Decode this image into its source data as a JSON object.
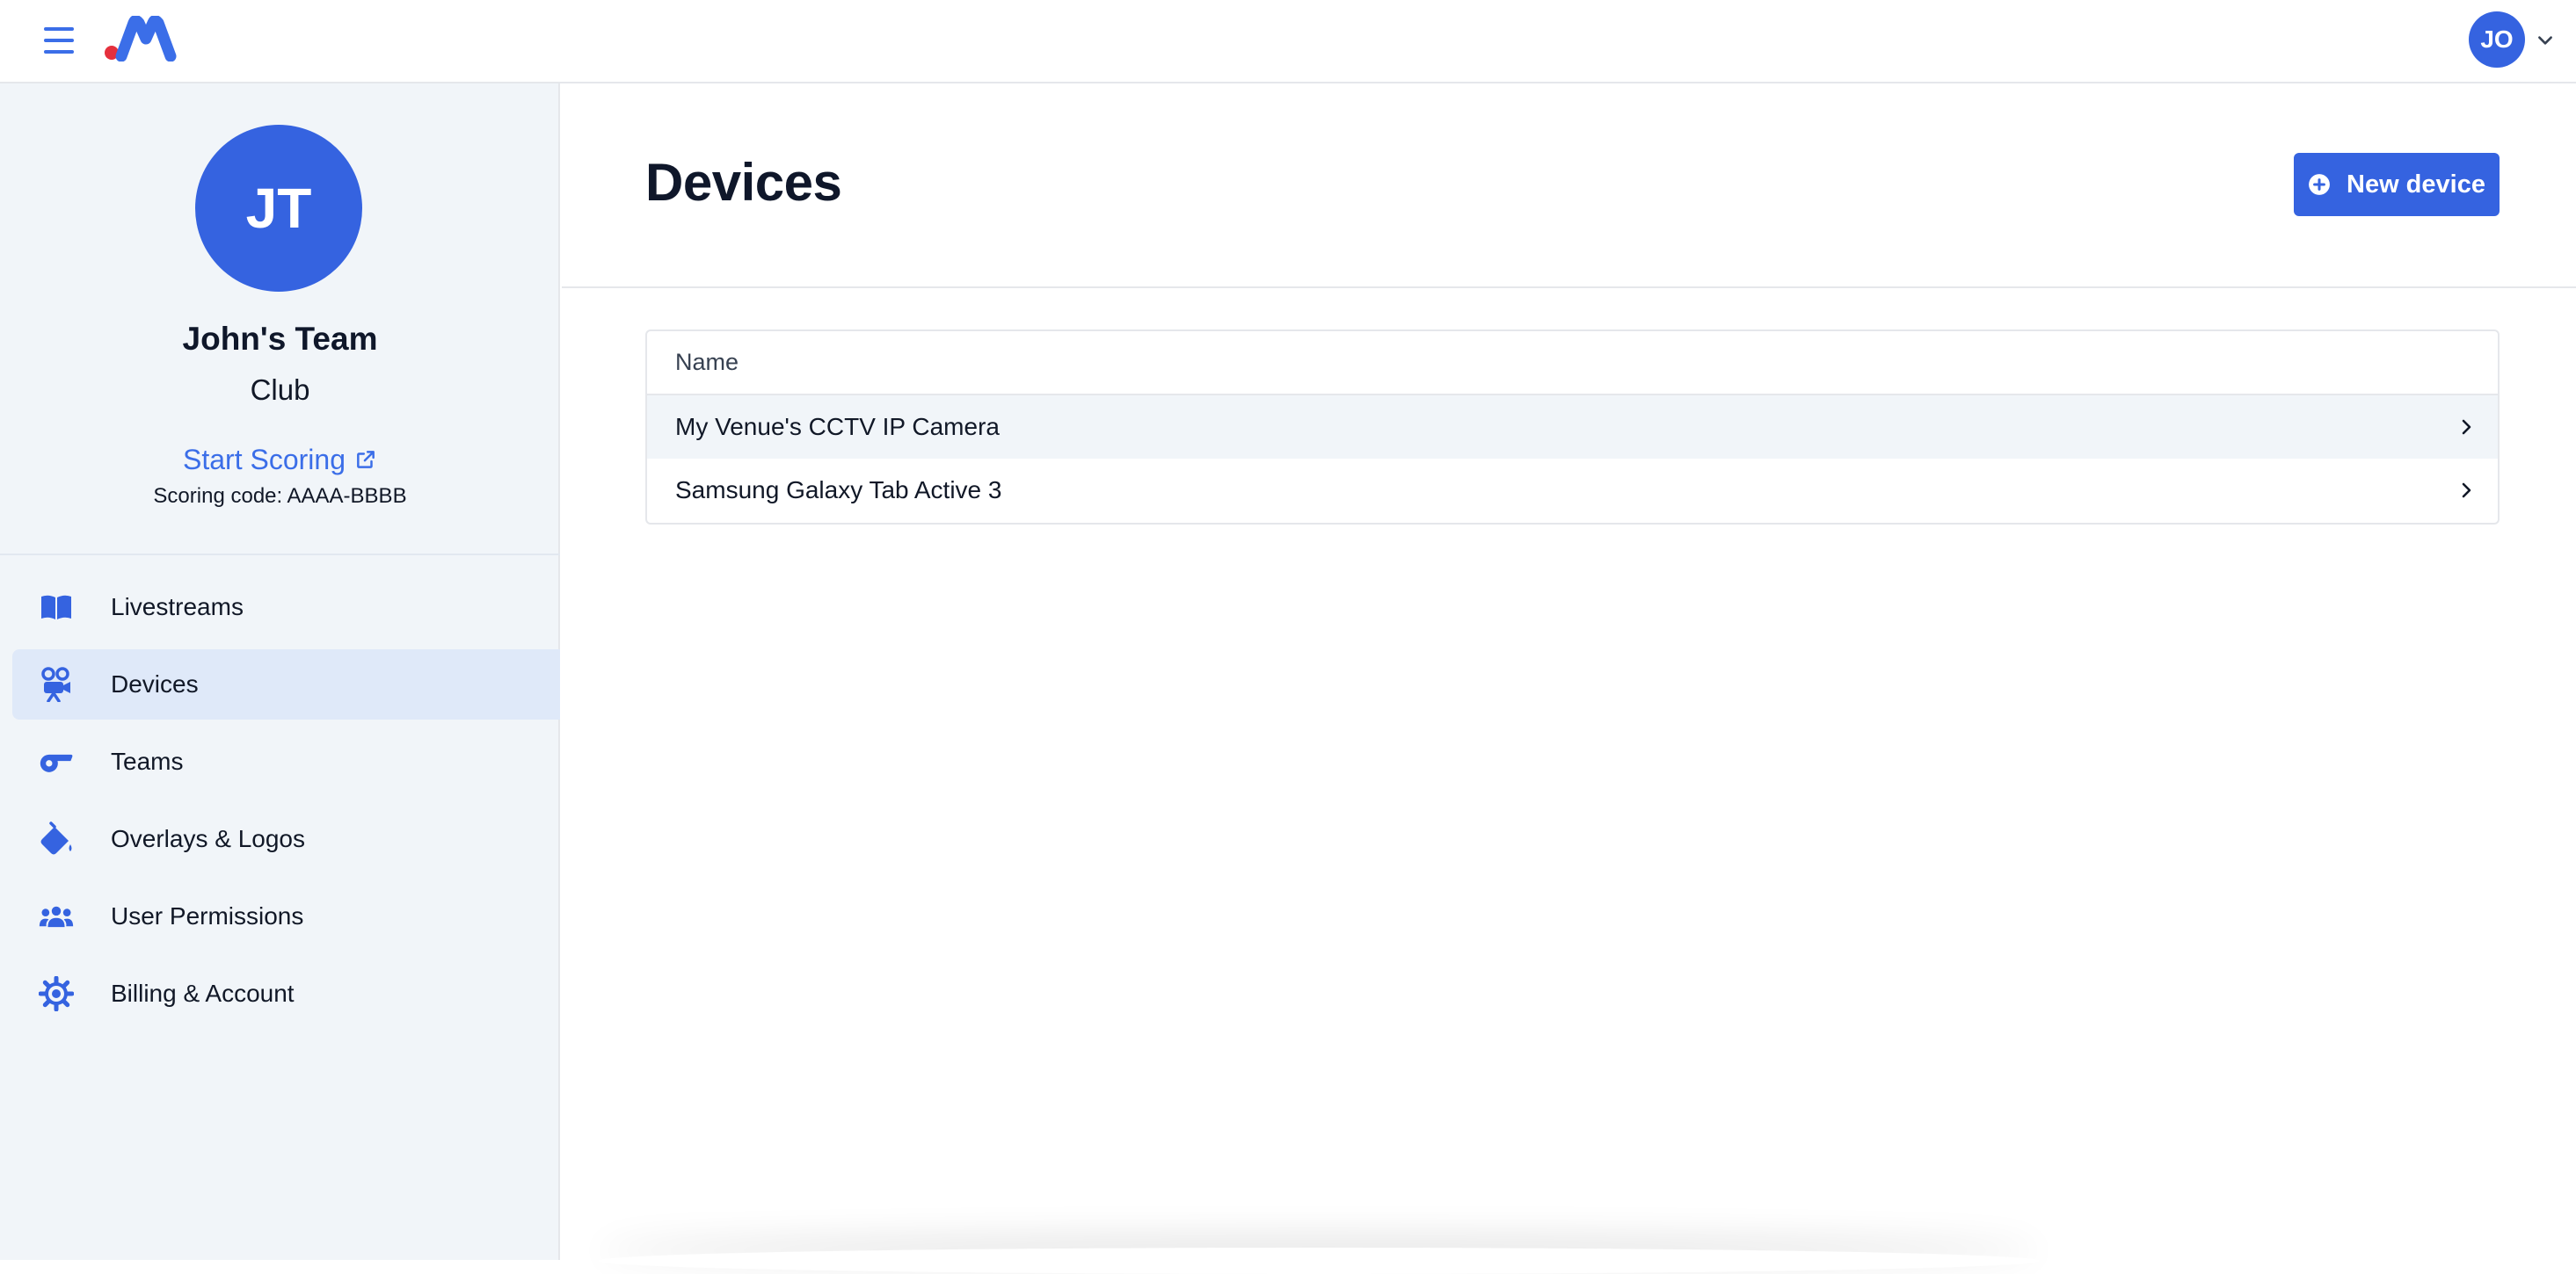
{
  "topbar": {
    "user_initials": "JO"
  },
  "team": {
    "initials": "JT",
    "name": "John's Team",
    "type": "Club",
    "start_scoring_label": "Start Scoring",
    "scoring_code": "Scoring code: AAAA-BBBB"
  },
  "sidebar": {
    "items": [
      {
        "label": "Livestreams",
        "icon": "book-open-icon",
        "active": false
      },
      {
        "label": "Devices",
        "icon": "video-camera-icon",
        "active": true
      },
      {
        "label": "Teams",
        "icon": "whistle-icon",
        "active": false
      },
      {
        "label": "Overlays & Logos",
        "icon": "paint-bucket-icon",
        "active": false
      },
      {
        "label": "User Permissions",
        "icon": "users-icon",
        "active": false
      },
      {
        "label": "Billing & Account",
        "icon": "gear-icon",
        "active": false
      }
    ]
  },
  "main": {
    "title": "Devices",
    "new_device_label": "New device",
    "table": {
      "column_name": "Name",
      "rows": [
        {
          "name": "My Venue's CCTV IP Camera"
        },
        {
          "name": "Samsung Galaxy Tab Active 3"
        }
      ]
    }
  },
  "colors": {
    "primary": "#3563e0",
    "link": "#3b6ee8",
    "sidebar_bg": "#f1f5f9",
    "active_item_bg": "#dfe9f9",
    "logo_red": "#e5303d"
  }
}
